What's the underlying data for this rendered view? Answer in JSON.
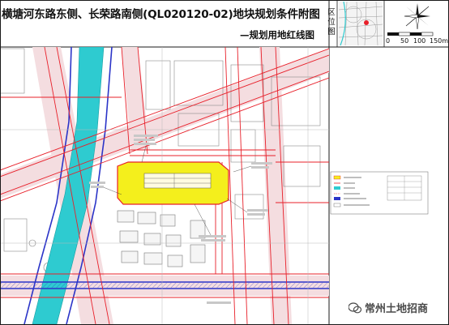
{
  "header": {
    "title": "横塘河东路东侧、长荣路南侧(QL020120-02)地块规划条件附图",
    "subtitle": "—规划用地红线图"
  },
  "location_panel": {
    "label_chars": [
      "区",
      "位",
      "图"
    ]
  },
  "scale_bar": {
    "ticks": [
      "0",
      "50",
      "100",
      "150"
    ],
    "unit": "m"
  },
  "watermark": {
    "text": "常州土地招商"
  },
  "colors": {
    "parcel_fill": "#f4ef1c",
    "river": "#2ecbd0",
    "red_line": "#e8202a",
    "blue_line": "#2b34c8",
    "road_fill": "#f2d6d8",
    "frame": "#1a1a1a"
  },
  "map_layers": [
    "parcel",
    "river",
    "roads",
    "red-lines",
    "blue-lines",
    "surrounding-buildings",
    "legend"
  ]
}
